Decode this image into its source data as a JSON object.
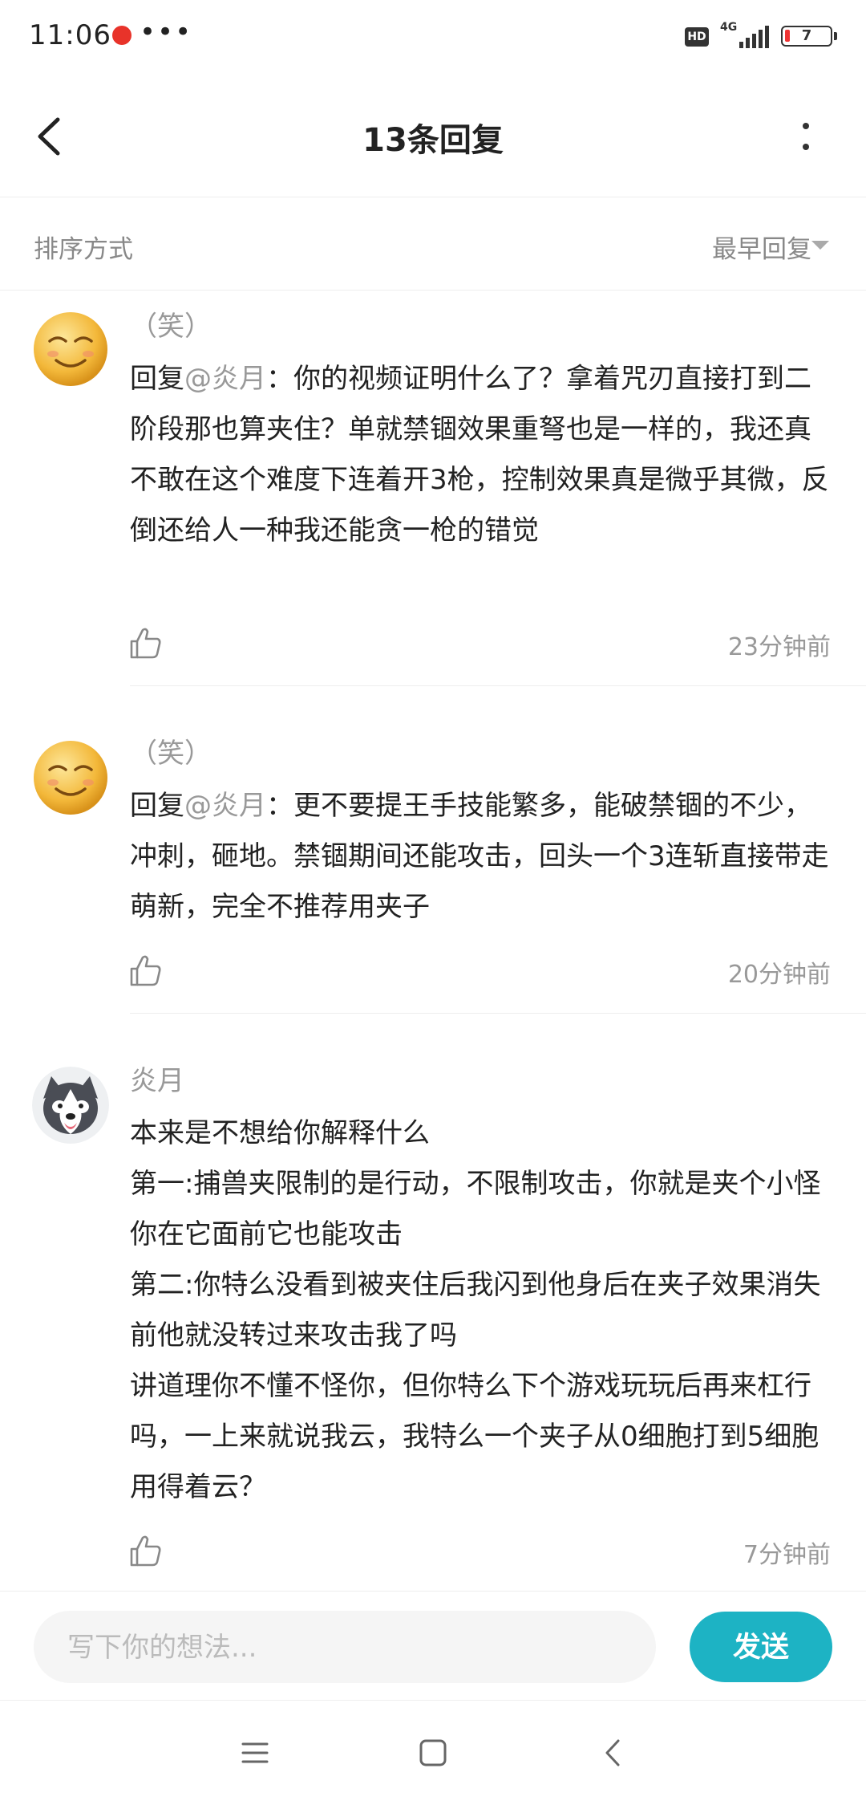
{
  "status_bar": {
    "time": "11:06",
    "dots": "•••",
    "hd": "HD",
    "network": "4G",
    "battery": "7"
  },
  "header": {
    "title": "13条回复"
  },
  "sort": {
    "label": "排序方式",
    "value": "最早回复"
  },
  "comments": [
    {
      "author": "（笑）",
      "reply_prefix": "回复",
      "mention": "@炎月",
      "text": "：你的视频证明什么了？拿着咒刃直接打到二阶段那也算夹住？单就禁锢效果重弩也是一样的，我还真不敢在这个难度下连着开3枪，控制效果真是微乎其微，反倒还给人一种我还能贪一枪的错觉",
      "time": "23分钟前"
    },
    {
      "author": "（笑）",
      "reply_prefix": "回复",
      "mention": "@炎月",
      "text": "：更不要提王手技能繁多，能破禁锢的不少，冲刺，砸地。禁锢期间还能攻击，回头一个3连斩直接带走萌新，完全不推荐用夹子",
      "time": "20分钟前"
    },
    {
      "author": "炎月",
      "lines": [
        "本来是不想给你解释什么",
        "第一:捕兽夹限制的是行动，不限制攻击，你就是夹个小怪你在它面前它也能攻击",
        "第二:你特么没看到被夹住后我闪到他身后在夹子效果消失前他就没转过来攻击我了吗",
        "讲道理你不懂不怪你，但你特么下个游戏玩玩后再来杠行吗，一上来就说我云，我特么一个夹子从0细胞打到5细胞用得着云？"
      ],
      "time": "7分钟前"
    }
  ],
  "input": {
    "placeholder": "写下你的想法...",
    "send_label": "发送"
  },
  "colors": {
    "accent": "#1db3c4",
    "secondary_text": "#999999",
    "primary_text": "#222222"
  },
  "icons": {
    "back": "chevron-left-icon",
    "more": "more-vertical-icon",
    "like": "thumbs-up-icon",
    "sort_caret": "caret-down-icon",
    "nav_menu": "menu-icon",
    "nav_home": "square-icon",
    "nav_back": "chevron-left-icon"
  }
}
